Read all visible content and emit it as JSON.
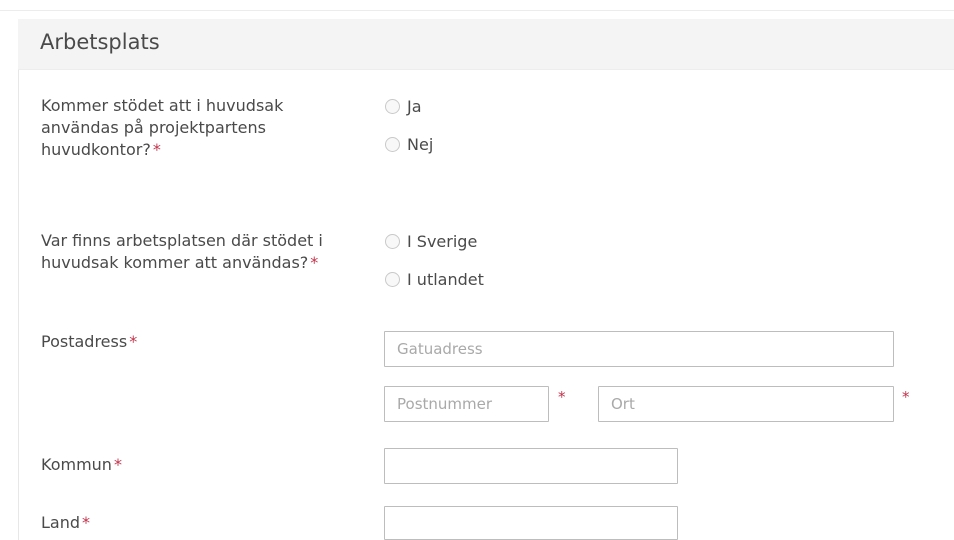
{
  "section": {
    "title": "Arbetsplats"
  },
  "required_marker": "*",
  "q_headquarters": {
    "label": "Kommer stödet att i huvudsak användas på projektpartens huvudkontor?",
    "options": [
      "Ja",
      "Nej"
    ]
  },
  "q_location": {
    "label": "Var finns arbetsplatsen där stödet i huvudsak kommer att användas?",
    "options": [
      "I Sverige",
      "I utlandet"
    ]
  },
  "postal": {
    "label": "Postadress",
    "street_placeholder": "Gatuadress",
    "zip_placeholder": "Postnummer",
    "city_placeholder": "Ort"
  },
  "municipality": {
    "label": "Kommun",
    "value": ""
  },
  "country": {
    "label": "Land",
    "value": ""
  },
  "colors": {
    "required": "#c2344c",
    "header_bg": "#f4f4f4",
    "border": "#bdbdbd"
  }
}
